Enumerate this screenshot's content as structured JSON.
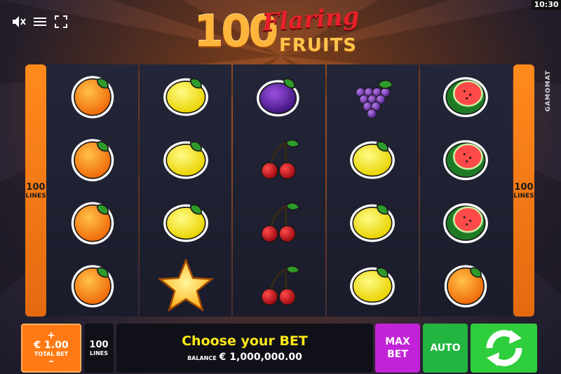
{
  "status": {
    "clock": "10:30"
  },
  "toolbar": {
    "icons": [
      "sound-muted-icon",
      "menu-icon",
      "fullscreen-icon"
    ]
  },
  "logo": {
    "number": "100",
    "flaring": "Flaring",
    "fruits": "FRUITS"
  },
  "brand": "GAMOMAT",
  "paylines": {
    "count": "100",
    "label": "LINES"
  },
  "reels": [
    [
      "orange",
      "orange",
      "orange",
      "orange"
    ],
    [
      "lemon",
      "lemon",
      "lemon",
      "star"
    ],
    [
      "plum",
      "cherry",
      "cherry",
      "cherry"
    ],
    [
      "grapes",
      "lemon",
      "lemon",
      "lemon"
    ],
    [
      "watermelon",
      "watermelon",
      "watermelon",
      "orange"
    ]
  ],
  "bet_panel": {
    "plus": "+",
    "minus": "–",
    "total_bet_value": "€ 1.00",
    "total_bet_label": "TOTAL BET",
    "lines_value": "100",
    "lines_label": "LINES",
    "message": "Choose your BET",
    "balance_label": "BALANCE",
    "balance_value": "€ 1,000,000.00",
    "max_bet_line1": "MAX",
    "max_bet_line2": "BET",
    "auto_label": "AUTO"
  },
  "colors": {
    "max_bet": "#c223d8",
    "auto": "#22b540",
    "spin": "#2fce3c",
    "total_bet": "#ff7a14",
    "message": "#ffe818"
  }
}
